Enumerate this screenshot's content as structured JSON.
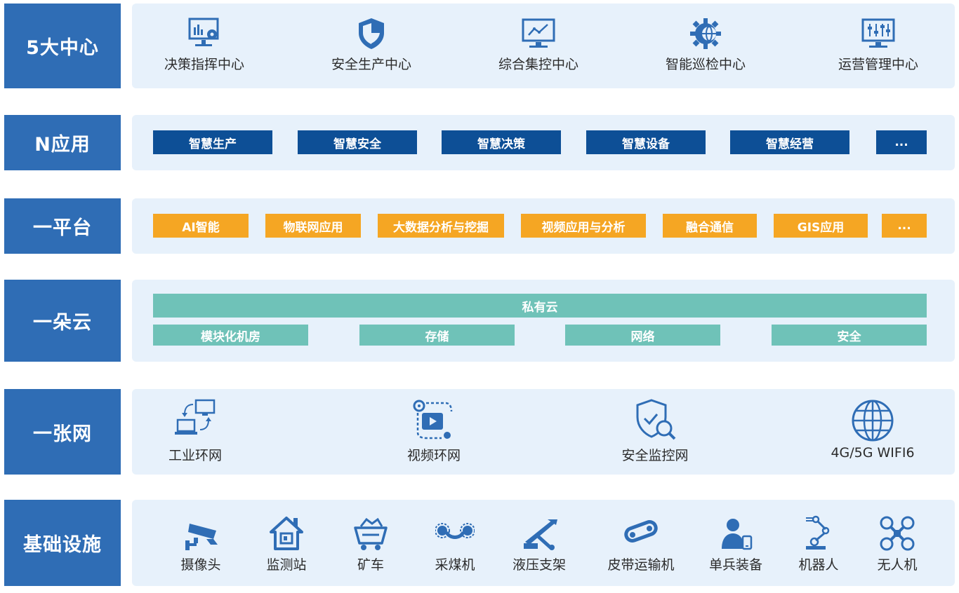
{
  "colors": {
    "label_bg": "#2f6db5",
    "panel_bg": "#e7f1fb",
    "blue_chip": "#0d4f96",
    "orange_chip": "#f5a623",
    "teal": "#6fc2b8",
    "icon": "#2f6db5"
  },
  "rows": {
    "centers": {
      "label": "5大中心",
      "items": [
        {
          "text": "决策指挥中心",
          "icon": "monitor-chart-gear-icon"
        },
        {
          "text": "安全生产中心",
          "icon": "shield-icon"
        },
        {
          "text": "综合集控中心",
          "icon": "monitor-line-chart-icon"
        },
        {
          "text": "智能巡检中心",
          "icon": "gear-globe-icon"
        },
        {
          "text": "运营管理中心",
          "icon": "monitor-sliders-icon"
        }
      ]
    },
    "apps": {
      "label": "N应用",
      "items": [
        "智慧生产",
        "智慧安全",
        "智慧决策",
        "智慧设备",
        "智慧经营",
        "..."
      ]
    },
    "platform": {
      "label": "一平台",
      "items": [
        "AI智能",
        "物联网应用",
        "大数据分析与挖掘",
        "视频应用与分析",
        "融合通信",
        "GIS应用",
        "..."
      ]
    },
    "cloud": {
      "label": "一朵云",
      "main": "私有云",
      "items": [
        "模块化机房",
        "存储",
        "网络",
        "安全"
      ]
    },
    "network": {
      "label": "一张网",
      "items": [
        {
          "text": "工业环网",
          "icon": "computer-sync-icon"
        },
        {
          "text": "视频环网",
          "icon": "video-play-icon"
        },
        {
          "text": "安全监控网",
          "icon": "shield-search-icon"
        },
        {
          "text": "4G/5G WIFI6",
          "icon": "globe-icon"
        }
      ]
    },
    "infra": {
      "label": "基础设施",
      "items": [
        {
          "text": "摄像头",
          "icon": "camera-icon"
        },
        {
          "text": "监测站",
          "icon": "house-icon"
        },
        {
          "text": "矿车",
          "icon": "mine-cart-icon"
        },
        {
          "text": "采煤机",
          "icon": "shearer-icon"
        },
        {
          "text": "液压支架",
          "icon": "hydraulic-support-icon"
        },
        {
          "text": "皮带运输机",
          "icon": "conveyor-belt-icon"
        },
        {
          "text": "单兵装备",
          "icon": "person-phone-icon"
        },
        {
          "text": "机器人",
          "icon": "robot-arm-icon"
        },
        {
          "text": "无人机",
          "icon": "drone-icon"
        }
      ]
    }
  }
}
